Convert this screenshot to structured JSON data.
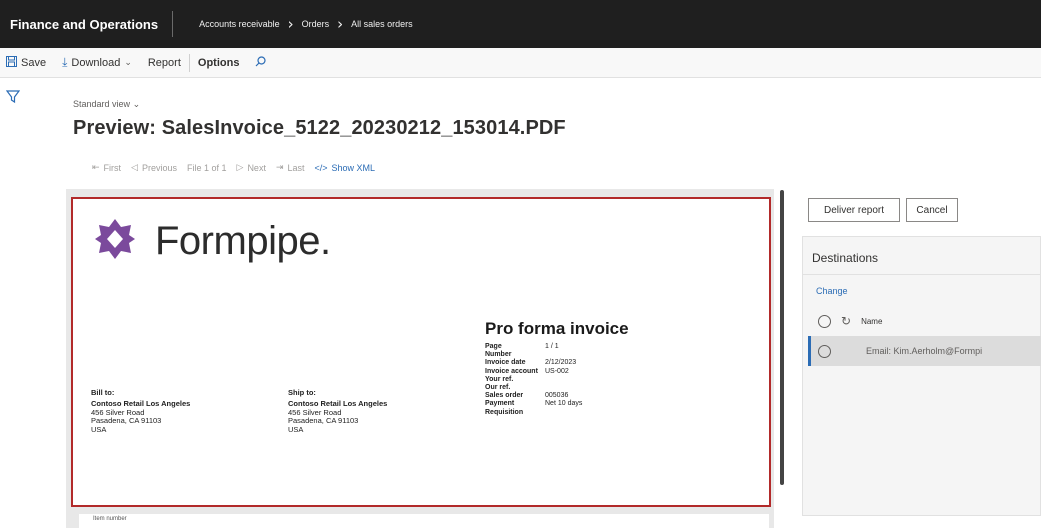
{
  "app": {
    "title": "Finance and Operations"
  },
  "breadcrumb": [
    "Accounts receivable",
    "Orders",
    "All sales orders"
  ],
  "actions": {
    "save": "Save",
    "download": "Download",
    "report": "Report",
    "options": "Options"
  },
  "header": {
    "view": "Standard view",
    "title": "Preview: SalesInvoice_5122_20230212_153014.PDF"
  },
  "navigation": {
    "first": "First",
    "previous": "Previous",
    "file_counter": "File 1 of 1",
    "next": "Next",
    "last": "Last",
    "show_xml": "Show XML"
  },
  "invoice": {
    "logo_text": "Formpipe.",
    "title": "Pro forma invoice",
    "fields": [
      {
        "label": "Page",
        "value": "1 / 1"
      },
      {
        "label": "Number",
        "value": ""
      },
      {
        "label": "Invoice date",
        "value": "2/12/2023"
      },
      {
        "label": "Invoice account",
        "value": "US-002"
      },
      {
        "label": "Your ref.",
        "value": ""
      },
      {
        "label": "Our ref.",
        "value": ""
      },
      {
        "label": "Sales order",
        "value": "005036"
      },
      {
        "label": "Payment",
        "value": "Net 10 days"
      },
      {
        "label": "Requisition",
        "value": ""
      }
    ],
    "bill_to": {
      "label": "Bill to:",
      "name": "Contoso Retail Los Angeles",
      "street": "456 Silver Road",
      "city": "Pasadena, CA 91103",
      "country": "USA"
    },
    "ship_to": {
      "label": "Ship to:",
      "name": "Contoso Retail Los Angeles",
      "street": "456 Silver Road",
      "city": "Pasadena, CA 91103",
      "country": "USA"
    },
    "next_page_header": "Item number"
  },
  "right_panel": {
    "deliver_button": "Deliver report",
    "cancel_button": "Cancel",
    "destinations_title": "Destinations",
    "change_link": "Change",
    "grid_header_name": "Name",
    "rows": [
      {
        "name": "Email: Kim.Aerholm@Formpi"
      }
    ]
  },
  "colors": {
    "accent": "#2b6cb5",
    "highlight_border": "#b22a2a",
    "logo_purple": "#7b4a9c",
    "topbar": "#1f1f1f"
  }
}
